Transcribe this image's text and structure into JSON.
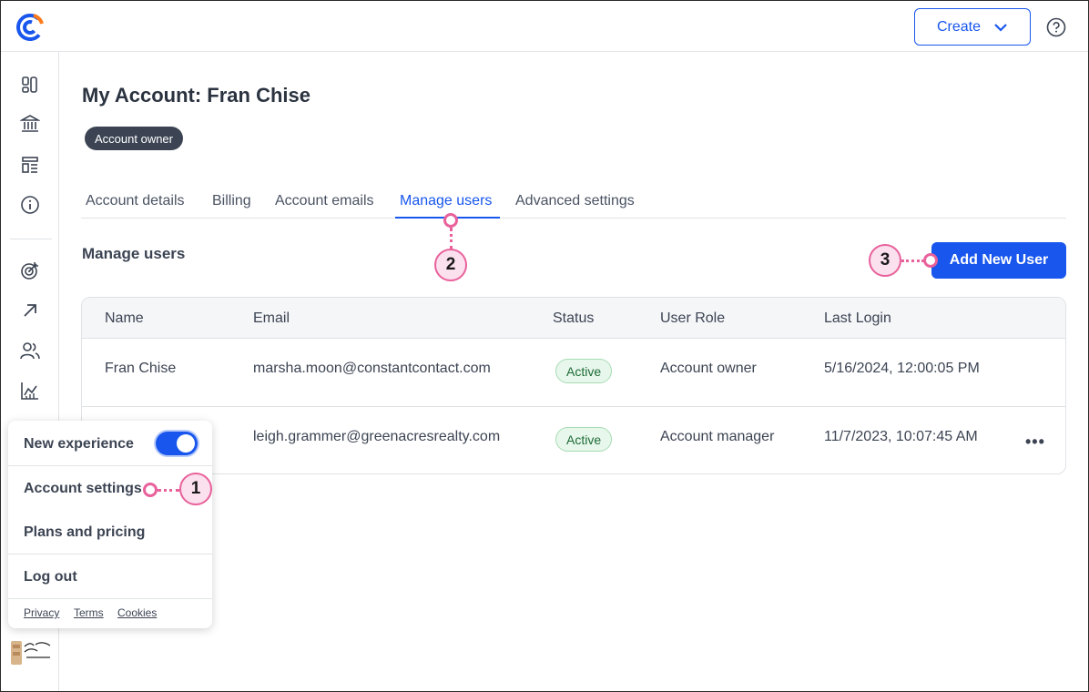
{
  "header": {
    "create_label": "Create"
  },
  "page": {
    "title": "My Account: Fran Chise",
    "badge": "Account owner"
  },
  "tabs": [
    {
      "label": "Account details"
    },
    {
      "label": "Billing"
    },
    {
      "label": "Account emails"
    },
    {
      "label": "Manage users",
      "active": true
    },
    {
      "label": "Advanced settings"
    }
  ],
  "section": {
    "title": "Manage users",
    "add_button": "Add New User"
  },
  "table": {
    "columns": [
      "Name",
      "Email",
      "Status",
      "User Role",
      "Last Login"
    ],
    "rows": [
      {
        "name": "Fran Chise",
        "email": "marsha.moon@constantcontact.com",
        "status": "Active",
        "role": "Account owner",
        "last_login": "5/16/2024, 12:00:05 PM"
      },
      {
        "name": "",
        "email": "leigh.grammer@greenacresrealty.com",
        "status": "Active",
        "role": "Account manager",
        "last_login": "11/7/2023, 10:07:45 AM"
      }
    ]
  },
  "popup": {
    "new_experience": "New experience",
    "new_experience_enabled": true,
    "account_settings": "Account settings",
    "plans_pricing": "Plans and pricing",
    "log_out": "Log out",
    "footer": {
      "privacy": "Privacy",
      "terms": "Terms",
      "cookies": "Cookies"
    }
  },
  "callouts": {
    "one": "1",
    "two": "2",
    "three": "3"
  },
  "colors": {
    "accent": "#1856ed",
    "callout": "#e8619b",
    "active_status": "#1c6b35"
  },
  "icons": [
    "logo-icon",
    "chevron-down-icon",
    "help-icon",
    "dashboard-icon",
    "bank-icon",
    "layout-icon",
    "info-icon",
    "target-icon",
    "arrow-up-right-icon",
    "users-icon",
    "chart-icon",
    "more-icon"
  ]
}
